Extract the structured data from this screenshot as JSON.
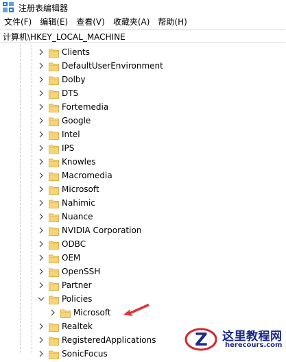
{
  "window": {
    "title": "注册表编辑器"
  },
  "menubar": {
    "items": [
      "文件(F)",
      "编辑(E)",
      "查看(V)",
      "收藏夹(A)",
      "帮助(H)"
    ]
  },
  "address": {
    "path": "计算机\\HKEY_LOCAL_MACHINE"
  },
  "tree": {
    "items": [
      {
        "label": "Clients",
        "expanded": false
      },
      {
        "label": "DefaultUserEnvironment",
        "expanded": false
      },
      {
        "label": "Dolby",
        "expanded": false
      },
      {
        "label": "DTS",
        "expanded": false
      },
      {
        "label": "Fortemedia",
        "expanded": false
      },
      {
        "label": "Google",
        "expanded": false
      },
      {
        "label": "Intel",
        "expanded": false
      },
      {
        "label": "IPS",
        "expanded": false
      },
      {
        "label": "Knowles",
        "expanded": false
      },
      {
        "label": "Macromedia",
        "expanded": false
      },
      {
        "label": "Microsoft",
        "expanded": false
      },
      {
        "label": "Nahimic",
        "expanded": false
      },
      {
        "label": "Nuance",
        "expanded": false
      },
      {
        "label": "NVIDIA Corporation",
        "expanded": false
      },
      {
        "label": "ODBC",
        "expanded": false
      },
      {
        "label": "OEM",
        "expanded": false
      },
      {
        "label": "OpenSSH",
        "expanded": false
      },
      {
        "label": "Partner",
        "expanded": false
      },
      {
        "label": "Policies",
        "expanded": true
      },
      {
        "label": "Microsoft",
        "expanded": false,
        "child": true
      },
      {
        "label": "Realtek",
        "expanded": false
      },
      {
        "label": "RegisteredApplications",
        "expanded": false
      },
      {
        "label": "SonicFocus",
        "expanded": false
      }
    ]
  },
  "watermark": {
    "title": "这里教程网",
    "domain": "herecours.com"
  },
  "colors": {
    "folder": "#f5d47a",
    "folder_edge": "#dcb24d",
    "arrow": "#e0323a",
    "watermark_blue": "#1b2a8a",
    "watermark_red": "#d42a2a"
  }
}
